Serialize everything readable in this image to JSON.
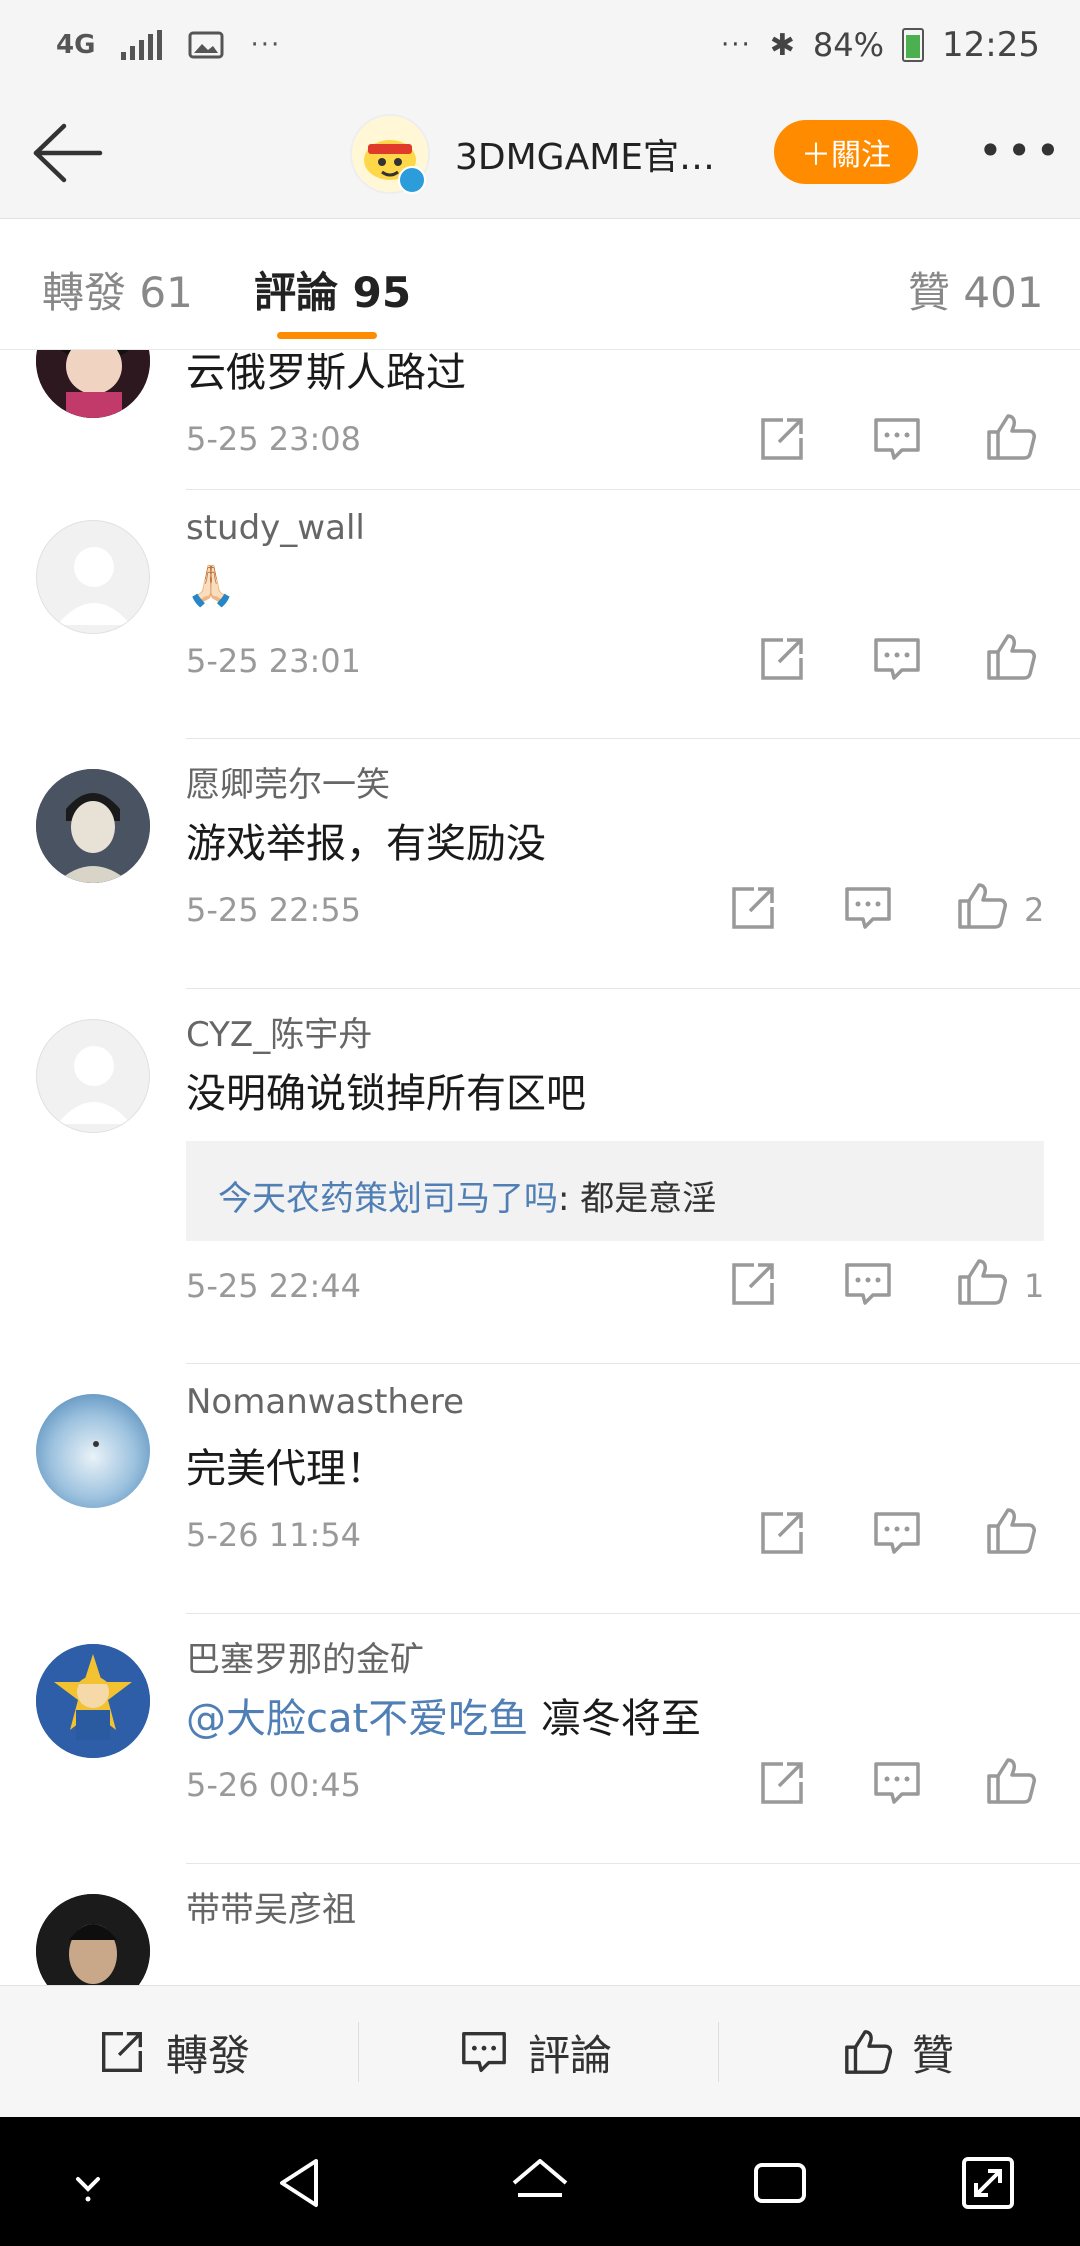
{
  "status_bar": {
    "network": "4G",
    "dots_left": "···",
    "dots_right": "···",
    "bluetooth": "✱",
    "battery_percent": "84%",
    "time": "12:25"
  },
  "nav": {
    "account_name": "3DMGAME官…",
    "follow_label": "＋關注",
    "more_label": "•••"
  },
  "tabs": {
    "repost": "轉發 61",
    "comments": "評論 95",
    "likes": "贊 401"
  },
  "comments": [
    {
      "username": "",
      "text": "云俄罗斯人路过",
      "time": "5-25 23:08",
      "likes": ""
    },
    {
      "username": "study_wall",
      "text": "🙏🏻",
      "time": "5-25 23:01",
      "likes": ""
    },
    {
      "username": "愿卿莞尔一笑",
      "text": "游戏举报，有奖励没",
      "time": "5-25 22:55",
      "likes": "2"
    },
    {
      "username": "CYZ_陈宇舟",
      "text": "没明确说锁掉所有区吧",
      "time": "5-25 22:44",
      "likes": "1",
      "reply": {
        "name": "今天农药策划司马了吗",
        "text": ": 都是意淫"
      }
    },
    {
      "username": "Nomanwasthere",
      "text": "完美代理！",
      "time": "5-26 11:54",
      "likes": ""
    },
    {
      "username": "巴塞罗那的金矿",
      "mention": "@大脸cat不爱吃鱼",
      "text": " 凛冬将至",
      "time": "5-26 00:45",
      "likes": ""
    },
    {
      "username": "带带吴彦祖"
    }
  ],
  "bottom_bar": {
    "repost": "轉發",
    "comment": "評論",
    "like": "贊"
  },
  "colors": {
    "accent": "#ff8c00",
    "link": "#4f7fb5",
    "meta_text": "#999999"
  }
}
